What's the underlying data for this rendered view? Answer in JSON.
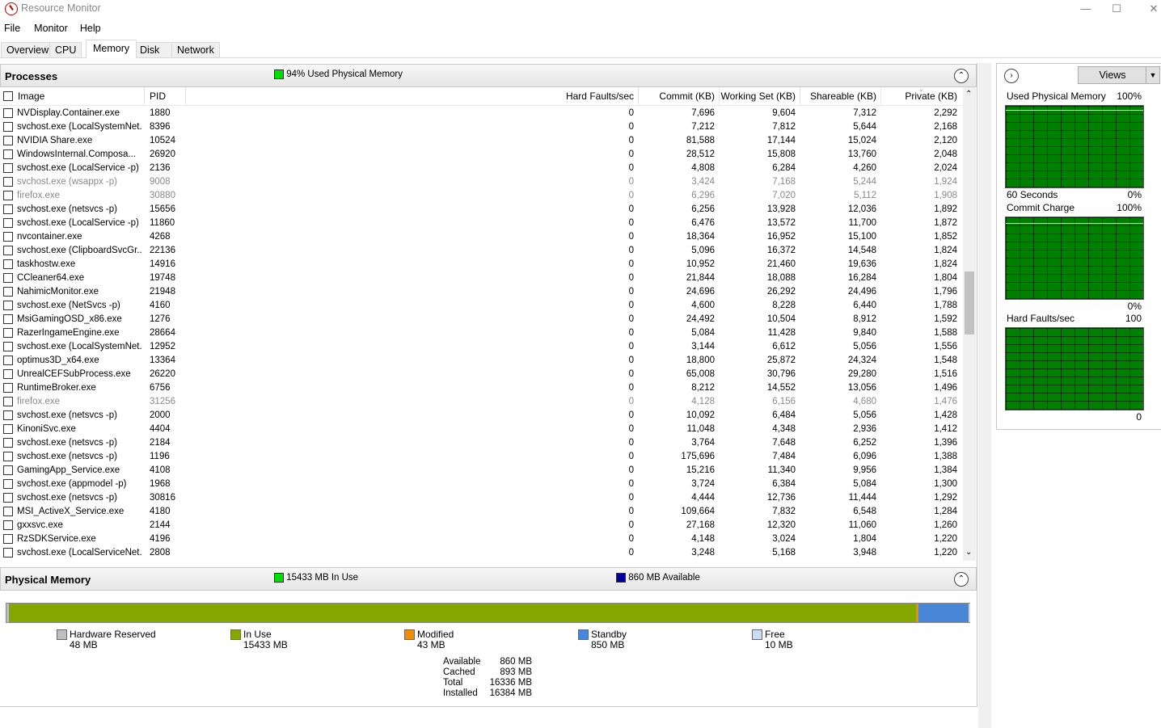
{
  "window": {
    "title": "Resource Monitor"
  },
  "menu": [
    "File",
    "Monitor",
    "Help"
  ],
  "tabs": [
    "Overview",
    "CPU",
    "Memory",
    "Disk",
    "Network"
  ],
  "processes": {
    "title": "Processes",
    "status": "94% Used Physical Memory",
    "status_color": "#00e000",
    "columns": [
      "Image",
      "PID",
      "Hard Faults/sec",
      "Commit (KB)",
      "Working Set (KB)",
      "Shareable (KB)",
      "Private (KB)"
    ],
    "rows": [
      [
        "NVDisplay.Container.exe",
        "1880",
        "0",
        "7,696",
        "9,604",
        "7,312",
        "2,292"
      ],
      [
        "svchost.exe (LocalSystemNet...",
        "8396",
        "0",
        "7,212",
        "7,812",
        "5,644",
        "2,168"
      ],
      [
        "NVIDIA Share.exe",
        "10524",
        "0",
        "81,588",
        "17,144",
        "15,024",
        "2,120"
      ],
      [
        "WindowsInternal.Composa...",
        "26920",
        "0",
        "28,512",
        "15,808",
        "13,760",
        "2,048"
      ],
      [
        "svchost.exe (LocalService -p)",
        "2136",
        "0",
        "4,808",
        "6,284",
        "4,260",
        "2,024"
      ],
      [
        "svchost.exe (wsappx -p)",
        "9008",
        "0",
        "3,424",
        "7,168",
        "5,244",
        "1,924"
      ],
      [
        "firefox.exe",
        "30880",
        "0",
        "6,296",
        "7,020",
        "5,112",
        "1,908"
      ],
      [
        "svchost.exe (netsvcs -p)",
        "15656",
        "0",
        "6,256",
        "13,928",
        "12,036",
        "1,892"
      ],
      [
        "svchost.exe (LocalService -p)",
        "11860",
        "0",
        "6,476",
        "13,572",
        "11,700",
        "1,872"
      ],
      [
        "nvcontainer.exe",
        "4268",
        "0",
        "18,364",
        "16,952",
        "15,100",
        "1,852"
      ],
      [
        "svchost.exe (ClipboardSvcGr...",
        "22136",
        "0",
        "5,096",
        "16,372",
        "14,548",
        "1,824"
      ],
      [
        "taskhostw.exe",
        "14916",
        "0",
        "10,952",
        "21,460",
        "19,636",
        "1,824"
      ],
      [
        "CCleaner64.exe",
        "19748",
        "0",
        "21,844",
        "18,088",
        "16,284",
        "1,804"
      ],
      [
        "NahimicMonitor.exe",
        "21948",
        "0",
        "24,696",
        "26,292",
        "24,496",
        "1,796"
      ],
      [
        "svchost.exe (NetSvcs -p)",
        "4160",
        "0",
        "4,600",
        "8,228",
        "6,440",
        "1,788"
      ],
      [
        "MsiGamingOSD_x86.exe",
        "1276",
        "0",
        "24,492",
        "10,504",
        "8,912",
        "1,592"
      ],
      [
        "RazerIngameEngine.exe",
        "28664",
        "0",
        "5,084",
        "11,428",
        "9,840",
        "1,588"
      ],
      [
        "svchost.exe (LocalSystemNet...",
        "12952",
        "0",
        "3,144",
        "6,612",
        "5,056",
        "1,556"
      ],
      [
        "optimus3D_x64.exe",
        "13364",
        "0",
        "18,800",
        "25,872",
        "24,324",
        "1,548"
      ],
      [
        "UnrealCEFSubProcess.exe",
        "26220",
        "0",
        "65,008",
        "30,796",
        "29,280",
        "1,516"
      ],
      [
        "RuntimeBroker.exe",
        "6756",
        "0",
        "8,212",
        "14,552",
        "13,056",
        "1,496"
      ],
      [
        "firefox.exe",
        "31256",
        "0",
        "4,128",
        "6,156",
        "4,680",
        "1,476"
      ],
      [
        "svchost.exe (netsvcs -p)",
        "2000",
        "0",
        "10,092",
        "6,484",
        "5,056",
        "1,428"
      ],
      [
        "KinoniSvc.exe",
        "4404",
        "0",
        "11,048",
        "4,348",
        "2,936",
        "1,412"
      ],
      [
        "svchost.exe (netsvcs -p)",
        "2184",
        "0",
        "3,764",
        "7,648",
        "6,252",
        "1,396"
      ],
      [
        "svchost.exe (netsvcs -p)",
        "1196",
        "0",
        "175,696",
        "7,484",
        "6,096",
        "1,388"
      ],
      [
        "GamingApp_Service.exe",
        "4108",
        "0",
        "15,216",
        "11,340",
        "9,956",
        "1,384"
      ],
      [
        "svchost.exe (appmodel -p)",
        "1968",
        "0",
        "3,724",
        "6,384",
        "5,084",
        "1,300"
      ],
      [
        "svchost.exe (netsvcs -p)",
        "30816",
        "0",
        "4,444",
        "12,736",
        "11,444",
        "1,292"
      ],
      [
        "MSI_ActiveX_Service.exe",
        "4180",
        "0",
        "109,664",
        "7,832",
        "6,548",
        "1,284"
      ],
      [
        "gxxsvc.exe",
        "2144",
        "0",
        "27,168",
        "12,320",
        "11,060",
        "1,260"
      ],
      [
        "RzSDKService.exe",
        "4196",
        "0",
        "4,148",
        "3,024",
        "1,804",
        "1,220"
      ],
      [
        "svchost.exe (LocalServiceNet...",
        "2808",
        "0",
        "3,248",
        "5,168",
        "3,948",
        "1,220"
      ]
    ],
    "dim_rows": [
      5,
      6,
      21
    ]
  },
  "physical_memory": {
    "title": "Physical Memory",
    "in_use_status": "15433 MB In Use",
    "available_status": "860 MB Available",
    "in_use_color": "#00e000",
    "available_color": "#0000a0",
    "bar": {
      "hardware_reserved": 48,
      "in_use": 15433,
      "modified": 43,
      "standby": 850,
      "free": 10
    },
    "legend": [
      {
        "label": "Hardware Reserved",
        "value": "48 MB",
        "color": "#bfbfbf"
      },
      {
        "label": "In Use",
        "value": "15433 MB",
        "color": "#84a800"
      },
      {
        "label": "Modified",
        "value": "43 MB",
        "color": "#f28c00"
      },
      {
        "label": "Standby",
        "value": "850 MB",
        "color": "#4a86d8"
      },
      {
        "label": "Free",
        "value": "10 MB",
        "color": "#c8dcf4"
      }
    ],
    "stats": [
      {
        "label": "Available",
        "value": "860 MB"
      },
      {
        "label": "Cached",
        "value": "893 MB"
      },
      {
        "label": "Total",
        "value": "16336 MB"
      },
      {
        "label": "Installed",
        "value": "16384 MB"
      }
    ]
  },
  "right_pane": {
    "views_label": "Views",
    "graphs": [
      {
        "title": "Used Physical Memory",
        "max": "100%",
        "bottom_left": "60 Seconds",
        "bottom_right": "0%",
        "level": 0.95
      },
      {
        "title": "Commit Charge",
        "max": "100%",
        "bottom_left": "",
        "bottom_right": "0%",
        "level": 0.93
      },
      {
        "title": "Hard Faults/sec",
        "max": "100",
        "bottom_left": "",
        "bottom_right": "0",
        "level": 0
      }
    ]
  }
}
